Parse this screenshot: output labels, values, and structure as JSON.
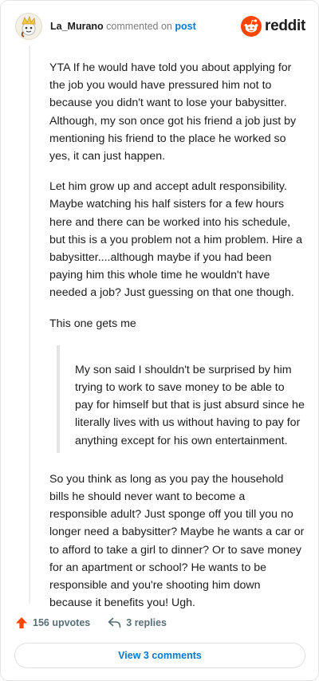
{
  "comment": {
    "username": "La_Murano",
    "commented_on": "commented on",
    "post_link": "post",
    "paragraphs": [
      "YTA If he would have told you about applying for the job you would have pressured him not to because you didn't want to lose your babysitter. Although, my son once got his friend a job just by mentioning his friend to the place he worked so yes, it can just happen.",
      "Let him grow up and accept adult responsibility. Maybe watching his half sisters for a few hours here and there can be worked into his schedule, but this is a you problem not a him problem. Hire a babysitter....although maybe if you had been paying him this whole time he wouldn't have needed a job? Just guessing on that one though.",
      "This one gets me"
    ],
    "quote": "My son said I shouldn't be surprised by him trying to work to save money to be able to pay for himself but that is just absurd since he literally lives with us without having to pay for anything except for his own entertainment.",
    "closing": "So you think as long as you pay the household bills he should never want to become a responsible adult? Just sponge off you till you no longer need a babysitter? Maybe he wants a car or to afford to take a girl to dinner? Or to save money for an apartment or school? He wants to be responsible and you're shooting him down because it benefits you! Ugh."
  },
  "brand": {
    "wordmark": "reddit",
    "color": "#ff4500"
  },
  "actions": {
    "upvotes": "156 upvotes",
    "replies": "3 replies"
  },
  "footer": {
    "view_comments": "View 3 comments"
  },
  "colors": {
    "link": "#0079d3",
    "upvote": "#ff4500",
    "muted": "#576f76"
  },
  "icons": [
    "avatar",
    "reddit-logo-icon",
    "upvote-arrow-icon",
    "reply-arrow-icon"
  ]
}
